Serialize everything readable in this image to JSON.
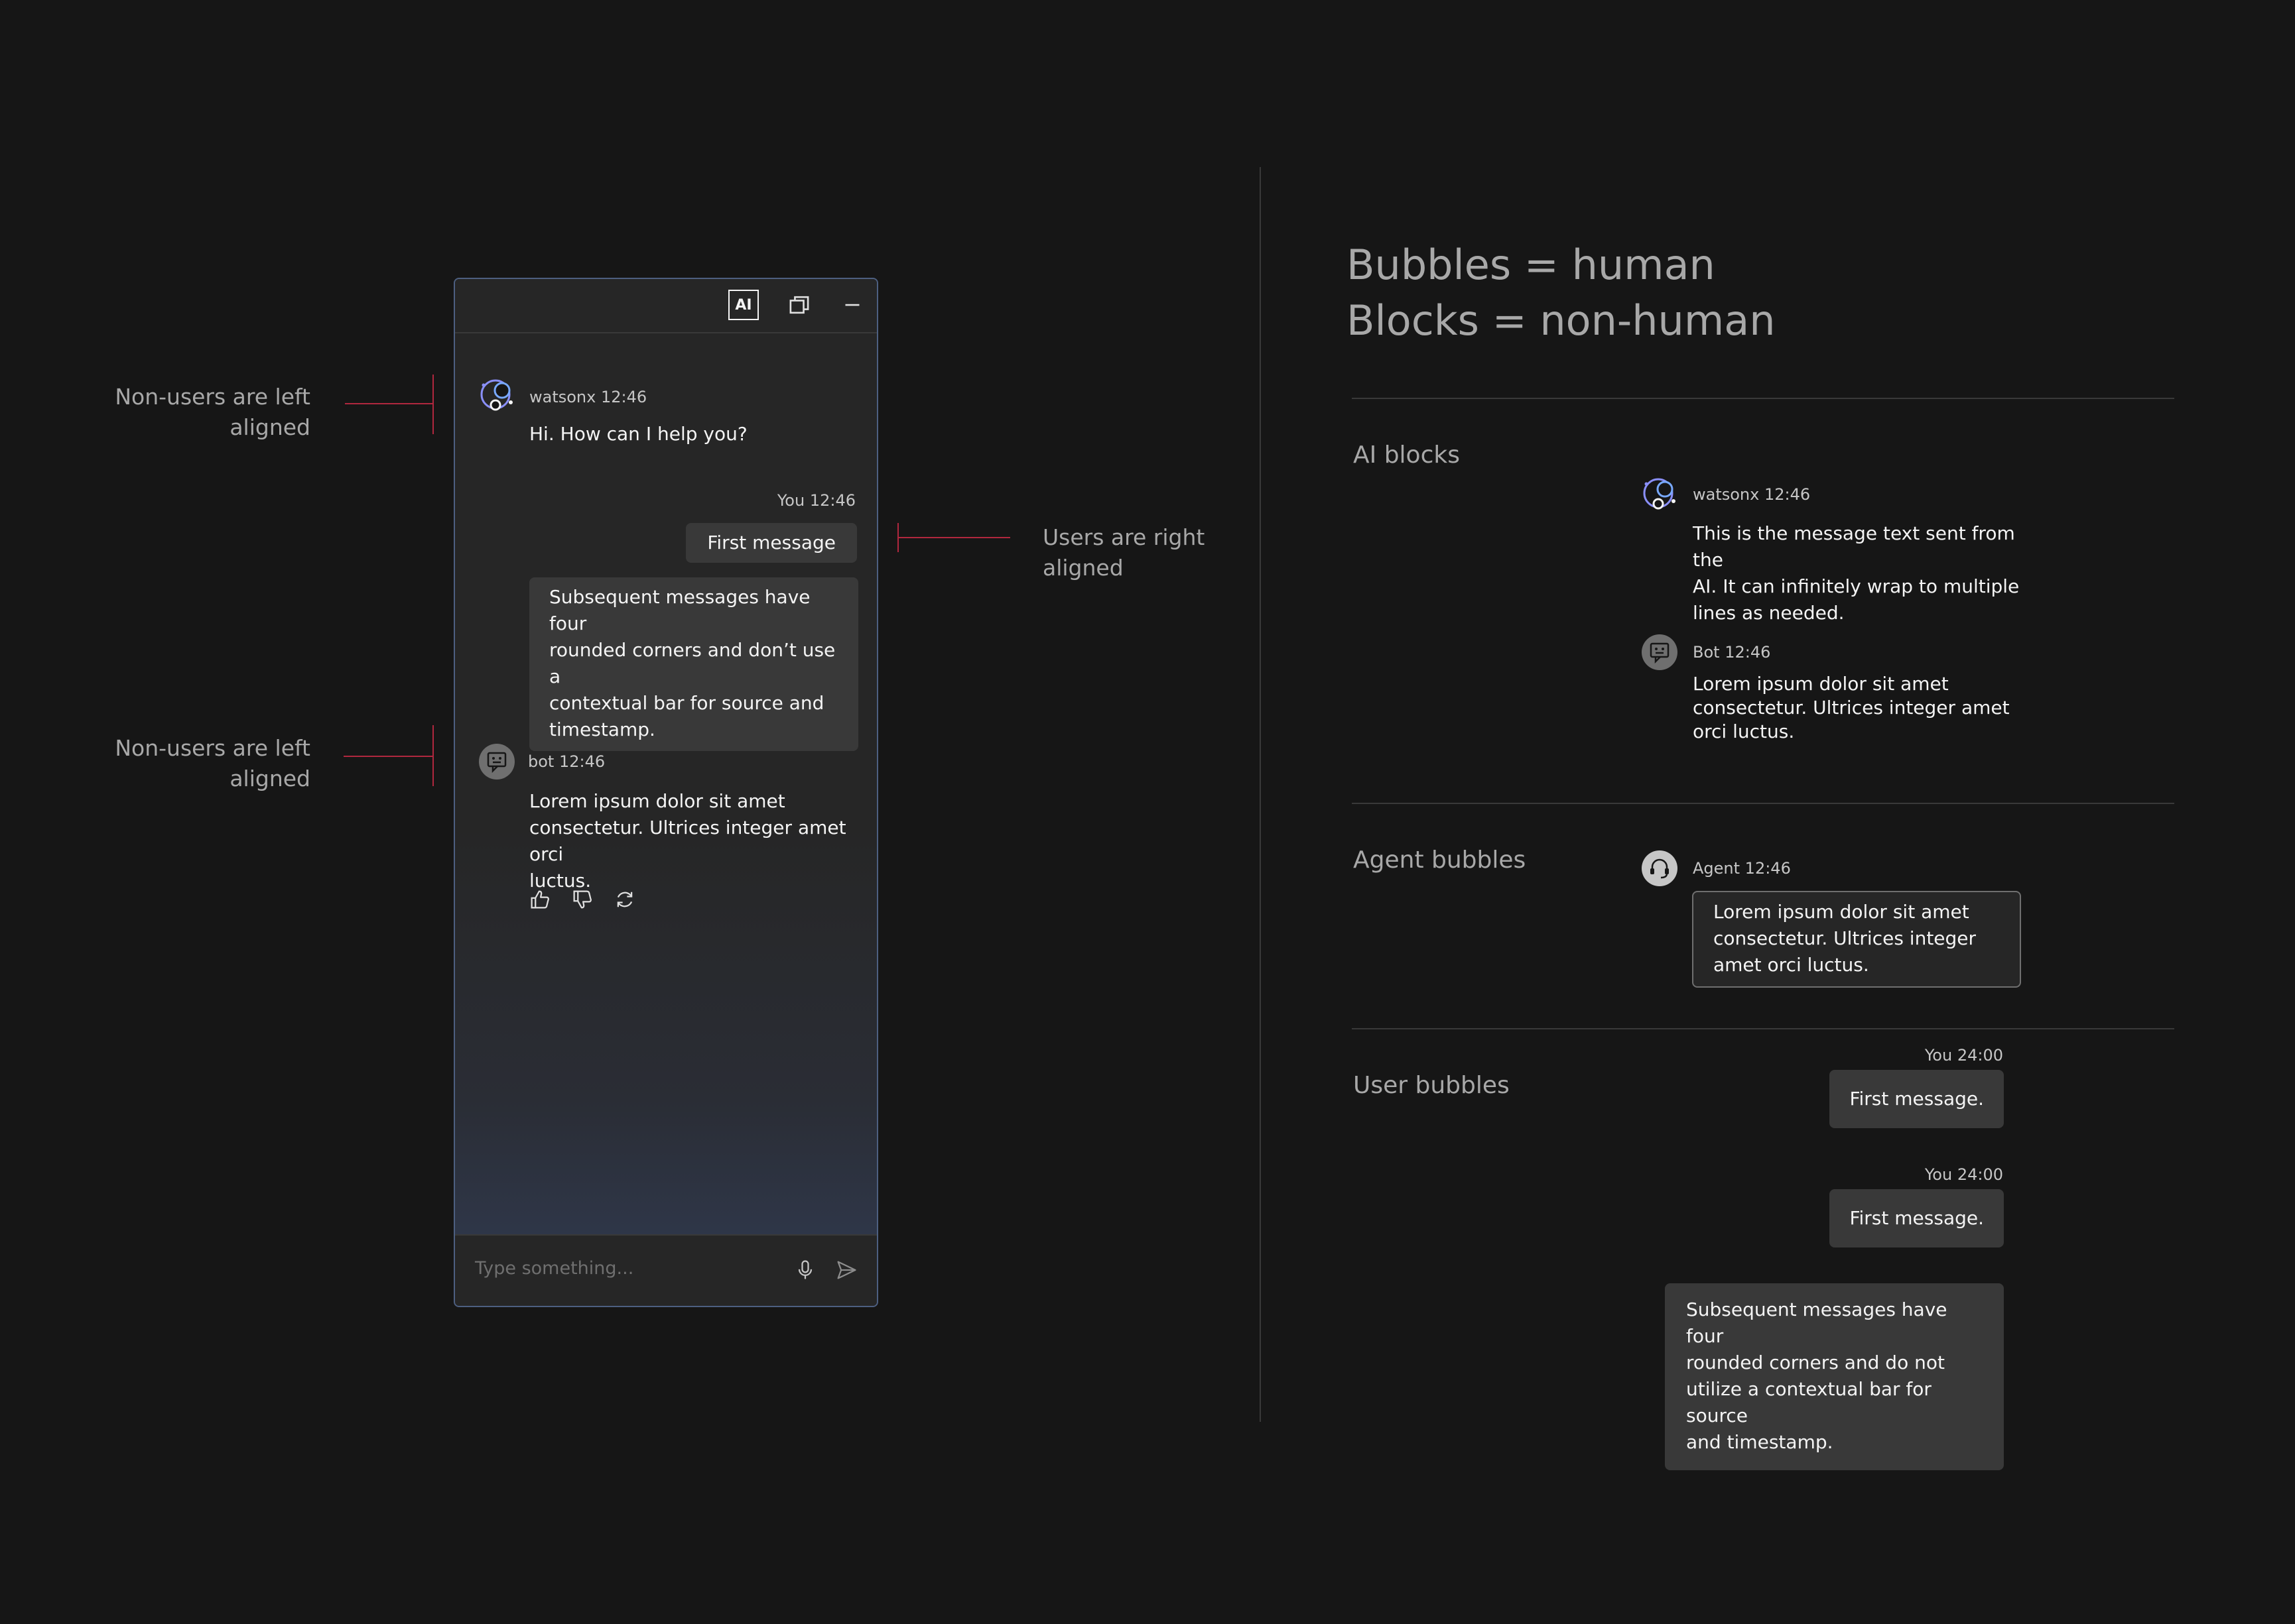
{
  "annotations": {
    "non_users_top": [
      "Non-users are left",
      "aligned"
    ],
    "non_users_bottom": [
      "Non-users are left",
      "aligned"
    ],
    "users_right": [
      "Users are right",
      "aligned"
    ]
  },
  "chat": {
    "header": {
      "ai_label": "AI"
    },
    "messages": {
      "watsonx": {
        "meta": "watsonx 12:46",
        "text": "Hi. How can I help you?"
      },
      "you": {
        "meta": "You 12:46",
        "first": "First message",
        "subsequent_lines": [
          "Subsequent messages have four",
          "rounded corners and don’t use a",
          "contextual bar for source and",
          "timestamp."
        ]
      },
      "bot": {
        "meta": "bot 12:46",
        "text_lines": [
          "Lorem ipsum dolor sit amet",
          "consectetur. Ultrices integer amet orci",
          "luctus."
        ]
      }
    },
    "input": {
      "placeholder": "Type something..."
    }
  },
  "panel": {
    "title_lines": [
      "Bubbles = human",
      "Blocks = non-human"
    ],
    "ai_blocks": {
      "title": "AI blocks",
      "watsonx": {
        "meta": "watsonx 12:46",
        "text_lines": [
          "This is the message text sent from the",
          "AI. It can infinitely wrap to multiple",
          "lines as needed."
        ]
      },
      "bot": {
        "meta": "Bot 12:46",
        "text_lines": [
          "Lorem ipsum dolor sit amet",
          "consectetur. Ultrices integer amet",
          "orci luctus."
        ]
      }
    },
    "agent_bubbles": {
      "title": "Agent bubbles",
      "meta": "Agent 12:46",
      "text_lines": [
        "Lorem ipsum dolor sit amet",
        "consectetur. Ultrices integer",
        "amet orci luctus."
      ]
    },
    "user_bubbles": {
      "title": "User bubbles",
      "first": {
        "meta": "You 24:00",
        "text": "First message."
      },
      "second": {
        "meta": "You 24:00",
        "text": "First message."
      },
      "subsequent_lines": [
        "Subsequent messages have four",
        "rounded corners and do not",
        "utilize a contextual bar for source",
        "and timestamp."
      ]
    }
  },
  "colors": {
    "background": "#161616",
    "annotation_line": "#b0273e",
    "bubble": "#393939",
    "window_border": "#4d5f80",
    "watsonx_accent": "#8a8ff8"
  },
  "icons": {
    "header": [
      "ai-icon",
      "launch-window-icon",
      "minimize-icon"
    ],
    "feedback": [
      "thumbs-up-icon",
      "thumbs-down-icon",
      "regenerate-icon"
    ],
    "input": [
      "microphone-icon",
      "send-icon"
    ]
  }
}
